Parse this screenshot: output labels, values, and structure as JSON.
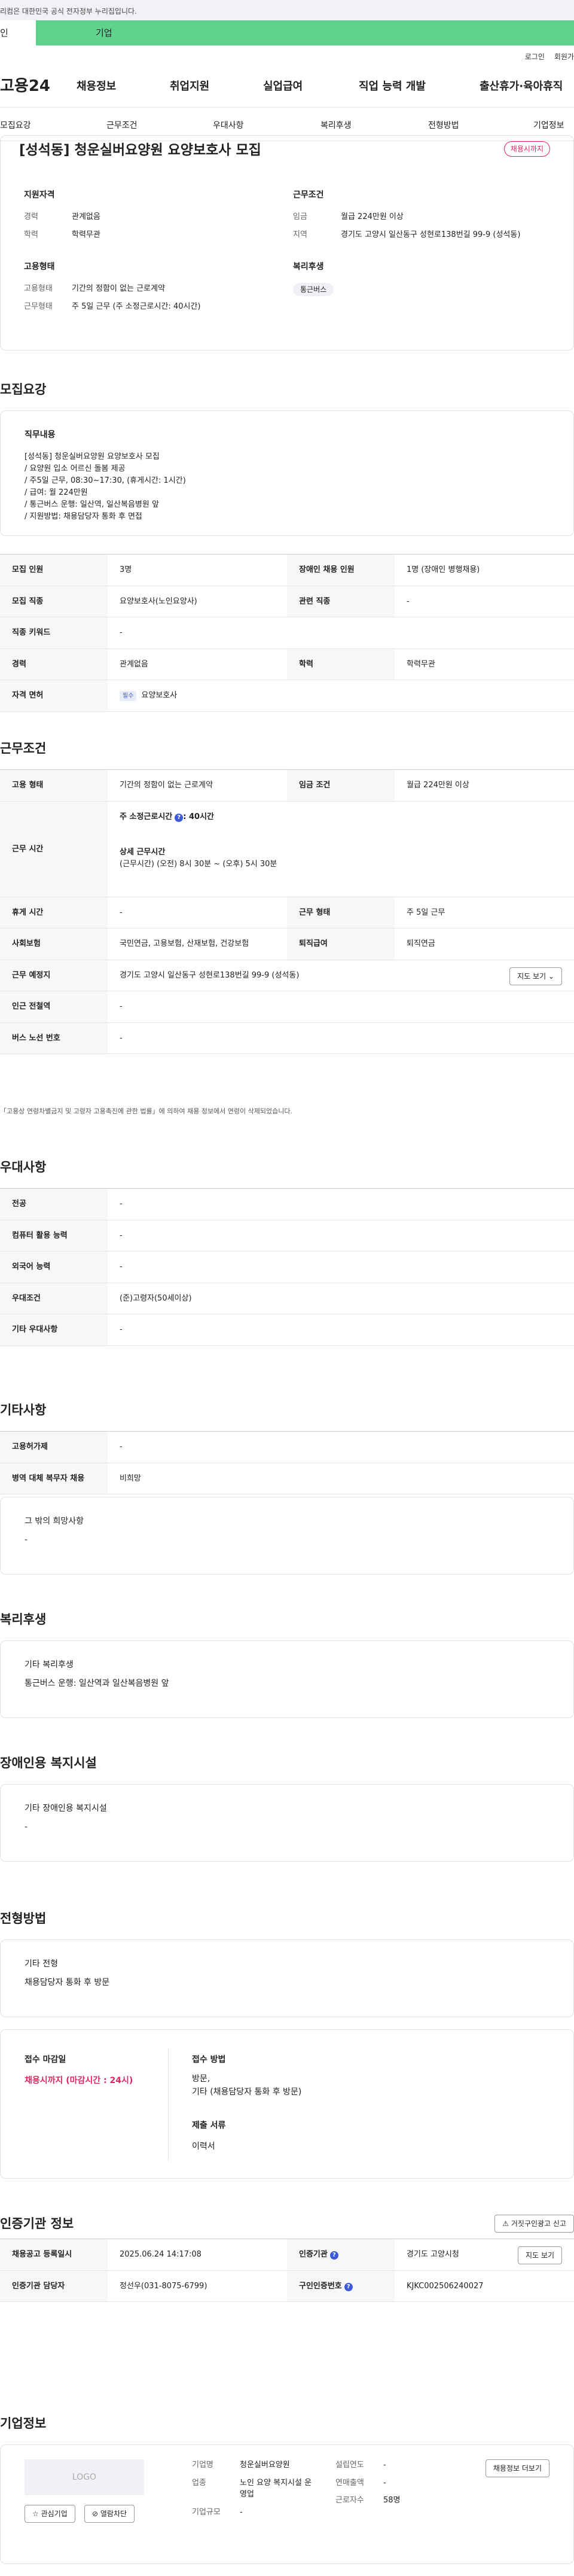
{
  "gov_notice": "리컴은 대한민국 공식 전자정부 누리집입니다.",
  "top_tabs": [
    "인",
    "기업"
  ],
  "util": [
    "로그인",
    "회원가"
  ],
  "logo": "고용24",
  "gnb": [
    "채용정보",
    "취업지원",
    "실업급여",
    "직업 능력 개발",
    "출산휴가·육아휴직"
  ],
  "anchors": [
    "모집요강",
    "근무조건",
    "우대사항",
    "복리후생",
    "전형방법",
    "기업정보"
  ],
  "header": {
    "title": "[성석동] 청운실버요양원 요양보호사 모집",
    "dday": "채용시까지",
    "qual_title": "지원자격",
    "qual": [
      {
        "k": "경력",
        "v": "관계없음"
      },
      {
        "k": "학력",
        "v": "학력무관"
      }
    ],
    "cond_title": "근무조건",
    "cond": [
      {
        "k": "임금",
        "v": "월급 224만원 이상"
      },
      {
        "k": "지역",
        "v": "경기도 고양시 일산동구 성현로138번길 99-9 (성석동)"
      }
    ],
    "emp_title": "고용형태",
    "emp": [
      {
        "k": "고용형태",
        "v": "기간의 정함이 없는 근로계약"
      },
      {
        "k": "근무형태",
        "v": "주 5일 근무 (주 소정근로시간: 40시간)"
      }
    ],
    "welfare_title": "복리후생",
    "welfare_chip": "통근버스"
  },
  "recruit": {
    "title": "모집요강",
    "duty_title": "직무내용",
    "duty_lines": [
      "[성석동] 청운실버요양원 요양보호사 모집",
      "/ 요양원 입소 어르신 돌봄 제공",
      "/ 주5일 근무, 08:30~17:30, (휴게시간: 1시간)",
      "/ 급여: 월 224만원",
      "/ 통근버스 운행: 일산역, 일산복음병원 앞",
      "/ 지원방법: 채용담당자 통화 후 면접"
    ],
    "rows": [
      {
        "k1": "모집 인원",
        "v1": "3명",
        "k2": "장애인 채용 인원",
        "v2": "1명 (장애인 병행채용)"
      },
      {
        "k1": "모집 직종",
        "v1": "요양보호사(노인요양사)",
        "k2": "관련 직종",
        "v2": "-"
      },
      {
        "k1": "직종 키워드",
        "v1": "-"
      },
      {
        "k1": "경력",
        "v1": "관계없음",
        "k2": "학력",
        "v2": "학력무관"
      },
      {
        "k1": "자격 면허",
        "badge": "필수",
        "v1": "요양보호사"
      }
    ]
  },
  "work": {
    "title": "근무조건",
    "r1": {
      "k1": "고용 형태",
      "v1": "기간의 정함이 없는 근로계약",
      "k2": "임금 조건",
      "v2": "월급 224만원 이상"
    },
    "hours_k": "근무 시간",
    "hours_main": "주 소정근로시간",
    "hours_main_v": ": 40시간",
    "hours_sub": "상세 근무시간",
    "hours_detail": "(근무시간) (오전) 8시 30분 ~ (오후) 5시 30분",
    "r3": {
      "k1": "휴게 시간",
      "v1": "-",
      "k2": "근무 형태",
      "v2": "주 5일 근무"
    },
    "r4": {
      "k1": "사회보험",
      "v1": "국민연금, 고용보험, 산재보험, 건강보험",
      "k2": "퇴직급여",
      "v2": "퇴직연금"
    },
    "r5": {
      "k1": "근무 예정지",
      "v1": "경기도 고양시 일산동구 성현로138번길 99-9 (성석동)",
      "btn": "지도 보기 ⌄"
    },
    "r6": {
      "k1": "인근 전철역",
      "v1": "-"
    },
    "r7": {
      "k1": "버스 노선 번호",
      "v1": "-"
    },
    "note": "「고용상 연령차별금지 및 고령자 고용촉진에 관한 법률」에 의하여 채용 정보에서 연령이 삭제되었습니다."
  },
  "pref": {
    "title": "우대사항",
    "rows": [
      {
        "k": "전공",
        "v": "-"
      },
      {
        "k": "컴퓨터 활용 능력",
        "v": "-"
      },
      {
        "k": "외국어 능력",
        "v": "-"
      },
      {
        "k": "우대조건",
        "v": "(준)고령자(50세이상)"
      },
      {
        "k": "기타 우대사항",
        "v": "-"
      }
    ]
  },
  "etc": {
    "title": "기타사항",
    "rows": [
      {
        "k": "고용허가제",
        "v": "-"
      },
      {
        "k": "병역 대체 복무자 채용",
        "v": "비희망"
      }
    ],
    "box_title": "그 밖의 희망사항",
    "box_val": "-"
  },
  "welfare": {
    "title": "복리후생",
    "box_title": "기타 복리후생",
    "box_val": "통근버스 운행: 일산역과 일산복음병원 앞"
  },
  "disabled": {
    "title": "장애인용 복지시설",
    "box_title": "기타 장애인용 복지시설",
    "box_val": "-"
  },
  "selection": {
    "title": "전형방법",
    "box_title": "기타 전형",
    "box_val": "채용담당자 통화 후 방문",
    "deadline_k": "접수 마감일",
    "deadline_v": "채용시까지 (마감시간 : 24시)",
    "method_k": "접수 방법",
    "method_v1": "방문,",
    "method_v2": "기타 (채용담당자 통화 후 방문)",
    "docs_k": "제출 서류",
    "docs_v": "이력서"
  },
  "cert": {
    "title": "인증기관 정보",
    "report_btn": "거짓구인광고 신고",
    "r1": {
      "k1": "채용공고 등록일시",
      "v1": "2025.06.24 14:17:08",
      "k2": "인증기관",
      "v2": "경기도 고양시청",
      "btn": "지도 보기"
    },
    "r2": {
      "k1": "인증기관 담당자",
      "v1": "정선우(031-8075-6799)",
      "k2": "구인인증번호",
      "v2": "KJKC002506240027"
    }
  },
  "company": {
    "title": "기업정보",
    "logo": "LOGO",
    "fav": "관심기업",
    "block": "열람차단",
    "list_btn": "채용정보 더보기",
    "f": [
      {
        "k": "기업명",
        "v": "청운실버요양원"
      },
      {
        "k": "업종",
        "v": "노인 요양 복지시설 운영업"
      },
      {
        "k": "기업규모",
        "v": "-"
      }
    ],
    "f2": [
      {
        "k": "설립연도",
        "v": "-"
      },
      {
        "k": "연매출액",
        "v": "-"
      },
      {
        "k": "근로자수",
        "v": "58명"
      }
    ]
  }
}
